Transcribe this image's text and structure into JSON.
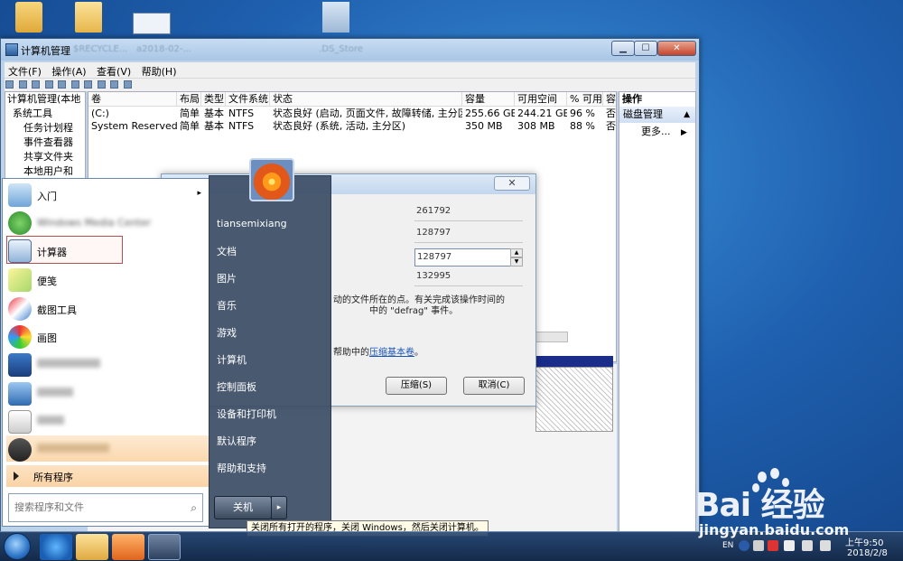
{
  "desktop": {
    "blurred_labels": [
      "$RECYCLE...",
      "a2018-02-...",
      ".DS_Store"
    ]
  },
  "computer_management": {
    "title": "计算机管理",
    "menu": [
      "文件(F)",
      "操作(A)",
      "查看(V)",
      "帮助(H)"
    ],
    "tree": [
      "计算机管理(本地",
      "系统工具",
      "任务计划程",
      "事件查看器",
      "共享文件夹",
      "本地用户和"
    ],
    "list_headers": [
      "卷",
      "布局",
      "类型",
      "文件系统",
      "状态",
      "容量",
      "可用空间",
      "% 可用",
      "容"
    ],
    "volumes": [
      {
        "name": "(C:)",
        "layout": "简单",
        "type": "基本",
        "fs": "NTFS",
        "status": "状态良好 (启动, 页面文件, 故障转储, 主分区)",
        "capacity": "255.66 GB",
        "free": "244.21 GB",
        "pct": "96 %",
        "fault": "否"
      },
      {
        "name": "System Reserved",
        "layout": "简单",
        "type": "基本",
        "fs": "NTFS",
        "status": "状态良好 (系统, 活动, 主分区)",
        "capacity": "350 MB",
        "free": "308 MB",
        "pct": "88 %",
        "fault": "否"
      }
    ],
    "actions": {
      "header": "操作",
      "section": "磁盘管理",
      "more": "更多..."
    }
  },
  "shrink_dialog": {
    "fields": [
      "261792",
      "128797",
      "128797",
      "132995"
    ],
    "text_line1": "动的文件所在的点。有关完成该操作时间的",
    "text_line2": "中的 \"defrag\" 事件。",
    "text_line3_prefix": "帮助中的",
    "text_line3_link": "压缩基本卷",
    "text_line3_suffix": "。",
    "close": "✕",
    "shrink_button": "压缩(S)",
    "cancel_button": "取消(C)"
  },
  "start_menu": {
    "left_items": [
      {
        "label": "入门",
        "blurred": false,
        "arrow": true
      },
      {
        "label": "Windows Media Center",
        "blurred": true,
        "arrow": false
      },
      {
        "label": "计算器",
        "blurred": false,
        "arrow": false
      },
      {
        "label": "便笺",
        "blurred": false,
        "arrow": false
      },
      {
        "label": "截图工具",
        "blurred": false,
        "arrow": false
      },
      {
        "label": "画图",
        "blurred": false,
        "arrow": false
      },
      {
        "label": "",
        "blurred": true,
        "arrow": false
      },
      {
        "label": "",
        "blurred": true,
        "arrow": false
      },
      {
        "label": "",
        "blurred": true,
        "arrow": false
      },
      {
        "label": "",
        "blurred": true,
        "arrow": false
      }
    ],
    "all_programs": "所有程序",
    "search_placeholder": "搜索程序和文件",
    "right_items": [
      "tiansemixiang",
      "文档",
      "图片",
      "音乐",
      "游戏",
      "计算机",
      "控制面板",
      "设备和打印机",
      "默认程序",
      "帮助和支持"
    ],
    "shutdown": "关机",
    "shutdown_arrow": "▸"
  },
  "tooltip": "关闭所有打开的程序，关闭 Windows，然后关闭计算机。",
  "taskbar": {
    "lang": "EN",
    "time": "上午9:50",
    "date": "2018/2/8"
  },
  "watermark": {
    "brand": "Bai  经验",
    "url": "jingyan.baidu.com"
  },
  "colors": {
    "desktop": "#1e5fae",
    "start_right": "#3c4e66",
    "highlight_border": "#b05050",
    "disk_bar": "#1a2d8a"
  }
}
